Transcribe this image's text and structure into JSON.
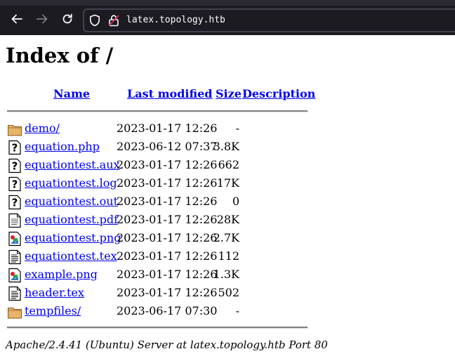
{
  "browser": {
    "url": "latex.topology.htb",
    "colors": {
      "toolbar": "#1c1b22",
      "urlbar_border": "#42414d",
      "lock_accent": "#e22850"
    }
  },
  "page": {
    "title": "Index of /",
    "columns": {
      "name": "Name",
      "last_modified": "Last modified",
      "size": "Size",
      "description": "Description"
    },
    "entries": [
      {
        "icon": "folder-icon",
        "name": "demo/",
        "modified": "2023-01-17 12:26",
        "size": "-"
      },
      {
        "icon": "unknown-file-icon",
        "name": "equation.php",
        "modified": "2023-06-12 07:37",
        "size": "3.8K"
      },
      {
        "icon": "unknown-file-icon",
        "name": "equationtest.aux",
        "modified": "2023-01-17 12:26",
        "size": "662"
      },
      {
        "icon": "unknown-file-icon",
        "name": "equationtest.log",
        "modified": "2023-01-17 12:26",
        "size": "17K"
      },
      {
        "icon": "unknown-file-icon",
        "name": "equationtest.out",
        "modified": "2023-01-17 12:26",
        "size": "0"
      },
      {
        "icon": "document-icon",
        "name": "equationtest.pdf",
        "modified": "2023-01-17 12:26",
        "size": "28K"
      },
      {
        "icon": "image-file-icon",
        "name": "equationtest.png",
        "modified": "2023-01-17 12:26",
        "size": "2.7K"
      },
      {
        "icon": "text-file-icon",
        "name": "equationtest.tex",
        "modified": "2023-01-17 12:26",
        "size": "112"
      },
      {
        "icon": "image-file-icon",
        "name": "example.png",
        "modified": "2023-01-17 12:26",
        "size": "1.3K"
      },
      {
        "icon": "text-file-icon",
        "name": "header.tex",
        "modified": "2023-01-17 12:26",
        "size": "502"
      },
      {
        "icon": "folder-icon",
        "name": "tempfiles/",
        "modified": "2023-06-17 07:30",
        "size": "-"
      }
    ],
    "footer": "Apache/2.4.41 (Ubuntu) Server at latex.topology.htb Port 80"
  }
}
